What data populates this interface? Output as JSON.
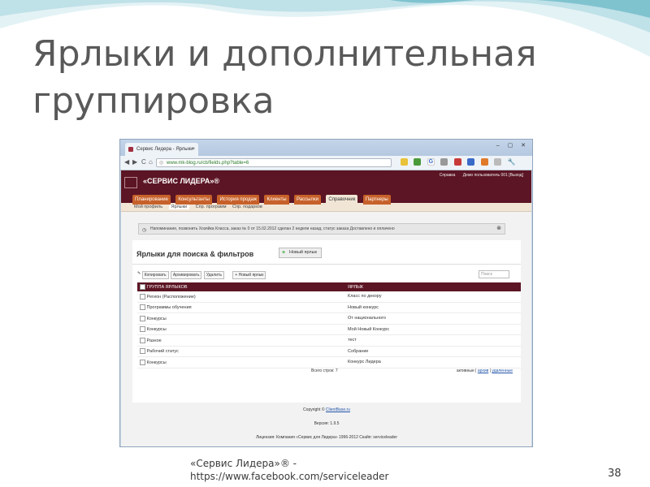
{
  "slide": {
    "title_line1": "Ярлыки и дополнительная",
    "title_line2": "группировка",
    "footer_line1": "«Сервис Лидера»® -",
    "footer_line2": "https://www.facebook.com/serviceleader",
    "page_number": "38",
    "colors": {
      "wave_light": "#e3f2f5",
      "wave_mid": "#bfe1e8",
      "wave_dark": "#7fc3cf"
    }
  },
  "browser": {
    "tab_title": "Сервис Лидера - Ярлыки",
    "tab_close": "×",
    "window_controls": "– ▢ ✕",
    "nav": {
      "back": "◀",
      "forward": "▶",
      "reload": "C",
      "home": "⌂"
    },
    "url": "www.mk-blog.ru/cb/fields.php?table=6",
    "extension_icons": [
      "yellow",
      "green",
      "google",
      "gray",
      "red",
      "blue",
      "orange",
      "gray",
      "wrench"
    ],
    "settings_icon": "wrench-icon"
  },
  "site": {
    "title": "«СЕРВИС ЛИДЕРА»®",
    "header_links": [
      "Справка",
      "Демо пользователь 001 [Выход]"
    ],
    "nav": [
      "Планирование",
      "Консультанты",
      "История продаж",
      "Клиенты",
      "Рассылки",
      "Справочник",
      "Партнеры"
    ],
    "active_nav": "Справочник",
    "subnav": [
      "Мой профиль",
      "Ярлыки",
      "Спр. программ",
      "Спр. подарков"
    ],
    "active_subnav": "Ярлыки",
    "reminder_text": "Напоминание, позвонить Хозяйка Класса, заказ № 0 от 15.02.2012 сделан 2 недели назад, статус заказа Доставлено и оплачено",
    "reminder_close": "⊗",
    "section_title": "Ярлыки для поиска & фильтров",
    "new_button": "Новый ярлык",
    "actions": [
      "Копировать",
      "Архивировать",
      "Удалить"
    ],
    "add_action": "+ Новый ярлык",
    "filter_placeholder": "Поиск",
    "table": {
      "columns": [
        "ГРУППА ЯРЛЫКОВ",
        "ЯРЛЫК"
      ],
      "rows": [
        [
          "Регион (Расположение)",
          "Класс по декору"
        ],
        [
          "Программы обучения",
          "Новый конкурс"
        ],
        [
          "Конкурсы",
          "От национального"
        ],
        [
          "Конкурсы",
          "Мой Новый Конкурс"
        ],
        [
          "Разное",
          "тест"
        ],
        [
          "Рабочий статус",
          "Собрание"
        ],
        [
          "Конкурсы",
          "Конкурс Лидера"
        ]
      ]
    },
    "total_rows": "Всего строк: 7",
    "status_label": "активные",
    "status_links": [
      "архив",
      "удаленные"
    ],
    "copyright_prefix": "Copyright ©",
    "copyright_link": "ClientBase.ru",
    "version": "Версия: 1.9.5",
    "license": "Лицензия: Компания «Сервис для Лидера» 1996-2012 Скайп: serviceleader"
  }
}
